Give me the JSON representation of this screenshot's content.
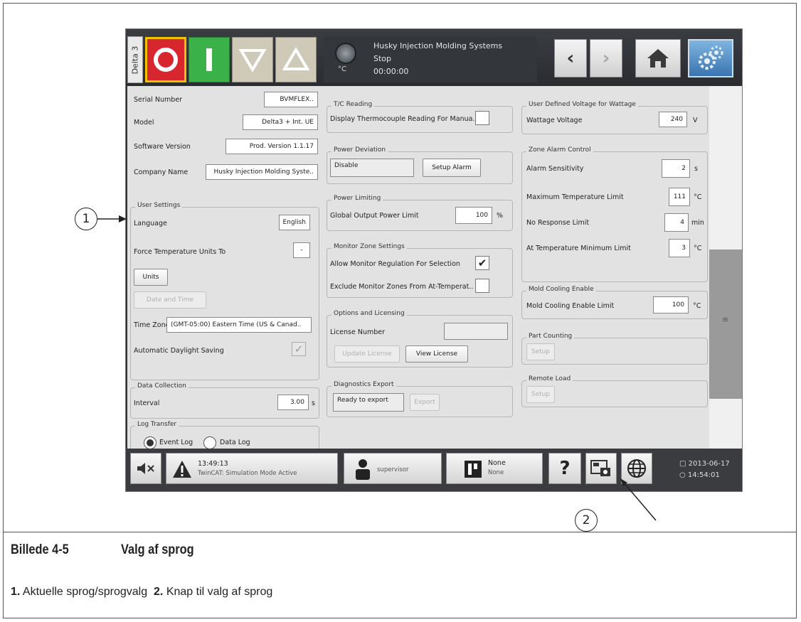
{
  "header": {
    "machine_tab": "Delta 3",
    "company": "Husky Injection Molding Systems",
    "state": "Stop",
    "timer": "00:00:00",
    "temp_unit": "°C"
  },
  "info": {
    "serial_label": "Serial Number",
    "serial_value": "BVMFLEX..",
    "model_label": "Model",
    "model_value": "Delta3 + Int. UE",
    "software_label": "Software Version",
    "software_value": "Prod. Version 1.1.17",
    "company_label": "Company Name",
    "company_value": "Husky Injection Molding Syste.."
  },
  "user_settings": {
    "title": "User Settings",
    "language_label": "Language",
    "language_value": "English",
    "force_units_label": "Force Temperature Units To",
    "force_units_value": "-",
    "units_button": "Units",
    "date_time_button": "Date and Time",
    "time_zone_label": "Time Zone",
    "time_zone_value": "(GMT-05:00) Eastern Time (US & Canad..",
    "daylight_label": "Automatic Daylight Saving"
  },
  "data_collection": {
    "title": "Data Collection",
    "interval_label": "Interval",
    "interval_value": "3.00",
    "interval_unit": "s"
  },
  "log_transfer": {
    "title": "Log Transfer",
    "event_log": "Event Log",
    "data_log": "Data Log"
  },
  "tc_reading": {
    "title": "T/C Reading",
    "label": "Display Thermocouple Reading For Manua.."
  },
  "power_deviation": {
    "title": "Power Deviation",
    "value": "Disable",
    "setup_button": "Setup Alarm"
  },
  "power_limiting": {
    "title": "Power Limiting",
    "label": "Global Output Power Limit",
    "value": "100",
    "unit": "%"
  },
  "monitor_zone": {
    "title": "Monitor Zone Settings",
    "allow_label": "Allow Monitor Regulation For Selection",
    "exclude_label": "Exclude Monitor Zones From At-Temperat.."
  },
  "licensing": {
    "title": "Options and Licensing",
    "license_label": "License Number",
    "license_value": "",
    "update_button": "Update License",
    "view_button": "View License"
  },
  "diagnostics": {
    "title": "Diagnostics Export",
    "status": "Ready to export",
    "export_button": "Export"
  },
  "wattage": {
    "title": "User Defined Voltage for Wattage",
    "label": "Wattage Voltage",
    "value": "240",
    "unit": "V"
  },
  "zone_alarm": {
    "title": "Zone Alarm Control",
    "sensitivity_label": "Alarm Sensitivity",
    "sensitivity_value": "2",
    "sensitivity_unit": "s",
    "max_temp_label": "Maximum Temperature Limit",
    "max_temp_value": "111",
    "max_temp_unit": "°C",
    "no_response_label": "No Response Limit",
    "no_response_value": "4",
    "no_response_unit": "min",
    "at_temp_label": "At Temperature Minimum Limit",
    "at_temp_value": "3",
    "at_temp_unit": "°C"
  },
  "mold_cooling": {
    "title": "Mold Cooling Enable",
    "label": "Mold Cooling Enable Limit",
    "value": "100",
    "unit": "°C"
  },
  "part_counting": {
    "title": "Part Counting",
    "setup_button": "Setup"
  },
  "remote_load": {
    "title": "Remote Load",
    "setup_button": "Setup"
  },
  "footer": {
    "alarm_time": "13:49:13",
    "alarm_text": "TwinCAT: Simulation Mode Active",
    "user": "supervisor",
    "mold_line1": "None",
    "mold_line2": "None",
    "help": "?",
    "date": "2013-06-17",
    "time": "14:54:01"
  },
  "callouts": {
    "one": "1",
    "two": "2"
  },
  "caption": {
    "figure_number": "Billede 4-5",
    "figure_title": "Valg af sprog",
    "item1_num": "1.",
    "item1_text": "Aktuelle sprog/sprogvalg",
    "item2_num": "2.",
    "item2_text": "Knap til valg af sprog"
  },
  "colors": {
    "stop": "#d8262e",
    "run": "#3bb249",
    "highlight": "#f2c200",
    "settings": "#3a74b0"
  },
  "icons": [
    "stop-icon",
    "run-icon",
    "down-triangle-icon",
    "up-triangle-icon",
    "gauge-icon",
    "back-arrow-icon",
    "forward-arrow-icon",
    "home-icon",
    "gear-icon",
    "mute-icon",
    "warning-icon",
    "user-icon",
    "mold-icon",
    "help-icon",
    "screenshot-icon",
    "globe-icon",
    "calendar-icon",
    "clock-icon"
  ]
}
